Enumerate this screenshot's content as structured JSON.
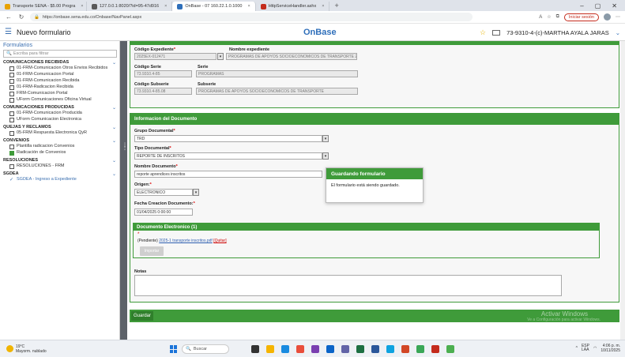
{
  "browser": {
    "tabs": [
      {
        "label": "Transporte SENA - $5.00 Progra",
        "icon_color": "#e8a200",
        "active": false
      },
      {
        "label": "127.0.0.1:8020/?id=95-47d916",
        "icon_color": "#5a5a5a",
        "active": false
      },
      {
        "label": "OnBase - 07 160.22.1.0.1000",
        "icon_color": "#2f6fba",
        "active": true
      },
      {
        "label": "HttpServiceHandler.ashx",
        "icon_color": "#c42b1c",
        "active": false
      }
    ],
    "new_tab": "+",
    "url": "https://onbase.sena.edu.co/Onbase/NavPanel.aspx",
    "signin_label": "Iniciar sesión"
  },
  "app": {
    "title": "Nuevo formulario",
    "logo": "OnBase",
    "user": "73-9310-4-(c)-MARTHA AYALA JARAS"
  },
  "sidebar": {
    "title": "Formularios",
    "search_placeholder": "Escriba para filtrar",
    "groups": [
      {
        "label": "COMUNICACIONES RECIBIDAS",
        "items": [
          {
            "label": "01-FRM-Comunicacion Otros Envios Recibidos",
            "icon": "form"
          },
          {
            "label": "01-FRM-Comunicacion Portal",
            "icon": "form"
          },
          {
            "label": "01-FRM-Comunicacion Recibida",
            "icon": "form"
          },
          {
            "label": "01-FRM-Radicacion Recibida",
            "icon": "form"
          },
          {
            "label": "FRM-Comunicacion Portal",
            "icon": "form"
          },
          {
            "label": "UForm Comunicaciones Oficina Virtual",
            "icon": "form"
          }
        ]
      },
      {
        "label": "COMUNICACIONES PRODUCIDAS",
        "items": [
          {
            "label": "01-FRM-Comunicacion Producida",
            "icon": "form"
          },
          {
            "label": "UForm Comunicacion Electronica",
            "icon": "form"
          }
        ]
      },
      {
        "label": "QUEJAS Y RECLAMOS",
        "items": [
          {
            "label": "05-FRM Respuesta Electronica QyR",
            "icon": "form"
          }
        ]
      },
      {
        "label": "CONVENIOS",
        "items": [
          {
            "label": "Plantilla radicacion Convenios",
            "icon": "form"
          },
          {
            "label": "Radicación de Convenios",
            "icon": "green"
          }
        ]
      },
      {
        "label": "RESOLUCIONES",
        "items": [
          {
            "label": "RESOLUCIONES - FRM",
            "icon": "form"
          }
        ]
      },
      {
        "label": "SGDEA",
        "items": [
          {
            "label": "SGDEA - Ingreso a Expediente",
            "icon": "check",
            "active": true
          }
        ]
      }
    ]
  },
  "form": {
    "expediente": {
      "codigo_label": "Código Expediente",
      "codigo_value": "2025EX-012471",
      "nombre_label": "Nombre expediente",
      "nombre_value": "PROGRAMAS DE APOYOS SOCIOECONOMICOS DE TRANSPORTE 2025",
      "cod_serie_label": "Código Serie",
      "cod_serie_value": "73.9310.4-85",
      "serie_label": "Serie",
      "serie_value": "PROGRAMAS",
      "cod_subserie_label": "Código Subserie",
      "cod_subserie_value": "73.9310.4-85.08",
      "subserie_label": "Subserie",
      "subserie_value": "PROGRAMAS DE APOYOS SOCIOECONOMICOS DE TRANSPORTE"
    },
    "documento": {
      "header": "Informacion del Documento",
      "grupo_label": "Grupo Documental",
      "grupo_value": "TRD",
      "tipo_label": "Tipo Documental",
      "tipo_value": "REPORTE DE INSCRITOS",
      "nombre_label": "Nombre Documento",
      "nombre_value": "reporte aprendices inscritos",
      "origen_label": "Origen:",
      "origen_value": "ELECTRONICO",
      "fecha_label": "Fecha Creacion Documento:",
      "fecha_value": "01/04/2025 0:00:00"
    },
    "electronico": {
      "header": "Documento Electronico (1)",
      "pending_prefix": "(Pendiente)",
      "file_link": "2025-1 transporte inscritos.pdf",
      "quit_label": "[Quitar]",
      "upload_label": "Importar"
    },
    "notas_label": "Notas",
    "save_label": "Guardar",
    "watermark_title": "Activar Windows",
    "watermark_sub": "Ve a Configuración para activar Windows."
  },
  "modal": {
    "title": "Guardando formulario",
    "message": "El formulario está siendo guardado."
  },
  "taskbar": {
    "temp": "19°C",
    "weather": "Mayorm. nublado",
    "search": "Buscar",
    "lang": "ESP\nLAA",
    "time": "4:06 p. m.",
    "date": "10/11/2025"
  }
}
